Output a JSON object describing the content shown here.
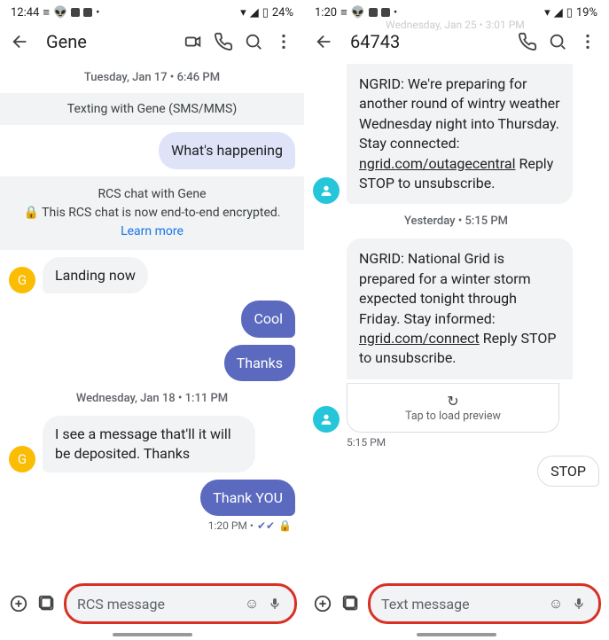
{
  "left": {
    "status": {
      "time": "12:44",
      "battery": "24%"
    },
    "title": "Gene",
    "date1": "Tuesday, Jan 17 • 6:46 PM",
    "banner1": "Texting with Gene (SMS/MMS)",
    "msg_happening": "What's happening",
    "rcs_banner_line1": "RCS chat with Gene",
    "rcs_banner_line2a": "This RCS chat is now end-to-end encrypted. ",
    "rcs_banner_link": "Learn more",
    "avatar_initial": "G",
    "msg_landing": "Landing now",
    "msg_cool": "Cool",
    "msg_thanks": "Thanks",
    "date2": "Wednesday, Jan 18 • 1:11 PM",
    "msg_deposit": "I see a message that'll it will be deposited. Thanks",
    "msg_thankyou": "Thank YOU",
    "time_under": "1:20 PM • ",
    "input_placeholder": "RCS message"
  },
  "right": {
    "status": {
      "time": "1:20",
      "battery": "19%"
    },
    "title": "64743",
    "header_date_ghost": "Wednesday, Jan 25 • 3:01 PM",
    "msg1a": "NGRID: We're preparing for another round of wintry weather Wednesday night into Thursday. Stay connected: ",
    "msg1_link": "ngrid.com/outagecentral",
    "msg1b": " Reply STOP to unsubscribe.",
    "date1": "Yesterday • 5:15 PM",
    "msg2a": "NGRID: National Grid is prepared for a winter storm expected tonight through Friday. Stay informed: ",
    "msg2_link": "ngrid.com/connect",
    "msg2b": " Reply STOP to unsubscribe.",
    "preview_label": "Tap to load preview",
    "time_under": "5:15 PM",
    "msg_stop": "STOP",
    "input_placeholder": "Text message"
  }
}
